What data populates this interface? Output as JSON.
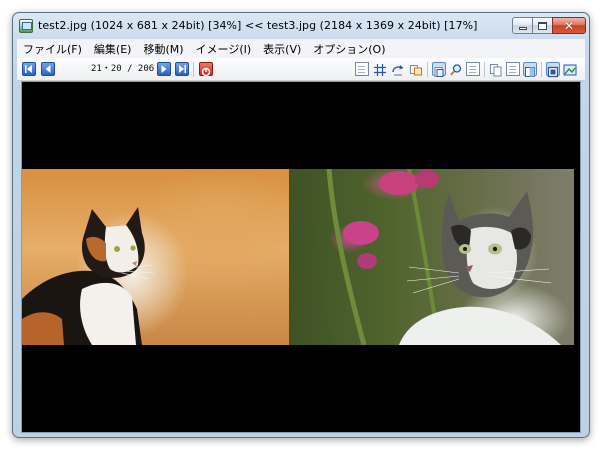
{
  "window": {
    "title": "test2.jpg (1024 x 681 x 24bit) [34%]   <<   test3.jpg (2184 x 1369 x 24bit) [17%]",
    "app_icon": "image-viewer-icon",
    "controls": {
      "minimize_icon": "minimize-icon",
      "maximize_icon": "maximize-icon",
      "close_icon": "close-icon",
      "close_glyph": "✕"
    }
  },
  "menu": {
    "items": [
      {
        "label": "ファイル(F)"
      },
      {
        "label": "編集(E)"
      },
      {
        "label": "移動(M)"
      },
      {
        "label": "イメージ(I)"
      },
      {
        "label": "表示(V)"
      },
      {
        "label": "オプション(O)"
      }
    ]
  },
  "toolbar": {
    "counter": "21・20 / 206",
    "icons": [
      "first-page-icon",
      "previous-page-icon",
      "next-page-icon",
      "last-page-icon",
      "stop-icon",
      "page-icon",
      "grid-icon",
      "rotate-icon",
      "copy-icon",
      "fit-window-icon",
      "zoom-icon",
      "single-page-icon",
      "double-page-left-icon",
      "double-page-right-icon",
      "spread-icon",
      "fullscreen-icon",
      "thumbnail-icon"
    ]
  },
  "viewer": {
    "left_image": "calico-cat-photo",
    "right_image": "tabby-cat-photo",
    "background": "#000000"
  }
}
